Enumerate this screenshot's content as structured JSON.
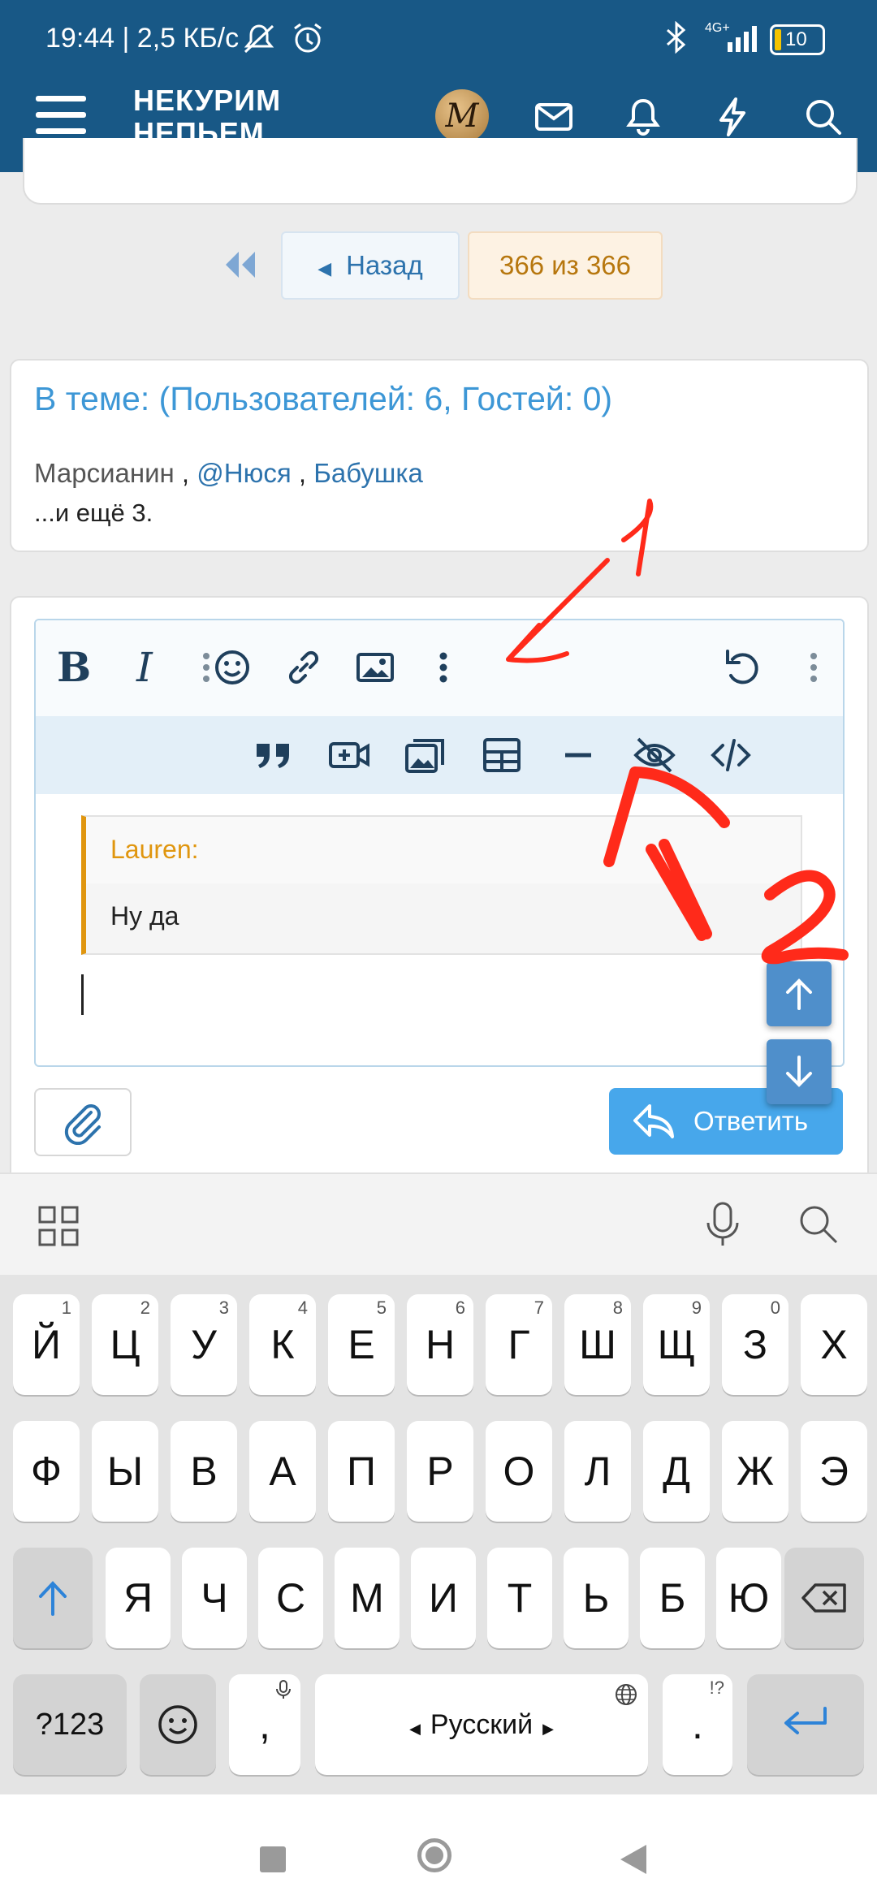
{
  "status_bar": {
    "left": "19:44 | 2,5 КБ/с",
    "network": "4G+",
    "battery": "10"
  },
  "header": {
    "site_title_line1": "НЕКУРИМ",
    "site_title_line2": "НЕПЬЕМ...",
    "avatar_letter": "M"
  },
  "pager": {
    "back_label": "Назад",
    "count": "366 из 366"
  },
  "online": {
    "title": "В теме: (Пользователей: 6, Гостей: 0)",
    "users": [
      "Марсианин",
      "@Нюся",
      "Бабушка"
    ],
    "more": "...и ещё 3."
  },
  "editor": {
    "quote_author": "Lauren:",
    "quote_text": "Ну да"
  },
  "reply_button": "Ответить",
  "keyboard": {
    "row1": [
      {
        "k": "Й",
        "h": "1"
      },
      {
        "k": "Ц",
        "h": "2"
      },
      {
        "k": "У",
        "h": "3"
      },
      {
        "k": "К",
        "h": "4"
      },
      {
        "k": "Е",
        "h": "5"
      },
      {
        "k": "Н",
        "h": "6"
      },
      {
        "k": "Г",
        "h": "7"
      },
      {
        "k": "Ш",
        "h": "8"
      },
      {
        "k": "Щ",
        "h": "9"
      },
      {
        "k": "З",
        "h": "0"
      },
      {
        "k": "Х",
        "h": ""
      }
    ],
    "row2": [
      "Ф",
      "Ы",
      "В",
      "А",
      "П",
      "Р",
      "О",
      "Л",
      "Д",
      "Ж",
      "Э"
    ],
    "row3": [
      "Я",
      "Ч",
      "С",
      "М",
      "И",
      "Т",
      "Ь",
      "Б",
      "Ю"
    ],
    "symbols_key": "?123",
    "comma_key": ",",
    "space_label": "Русский",
    "period_key": ".",
    "period_hint": "!?"
  },
  "annotations": [
    "1",
    "2"
  ],
  "colors": {
    "header_bg": "#185886",
    "link": "#2d73ad",
    "accent": "#47a7eb",
    "quote_bar": "#e0960f",
    "annotation": "#ff2a1a"
  }
}
